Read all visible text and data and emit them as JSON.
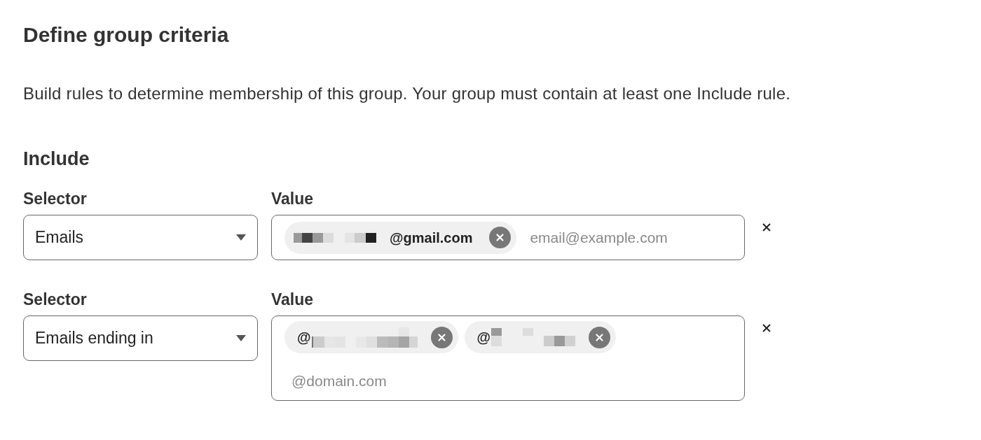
{
  "title": "Define group criteria",
  "description": "Build rules to determine membership of this group. Your group must contain at least one Include rule.",
  "include": {
    "heading": "Include",
    "rules": [
      {
        "selector": {
          "label": "Selector",
          "value": "Emails"
        },
        "value": {
          "label": "Value",
          "chips": [
            {
              "parts": [
                {
                  "kind": "redacted"
                },
                {
                  "kind": "text",
                  "text": "@gmail.com"
                }
              ]
            }
          ],
          "placeholder": "email@example.com"
        }
      },
      {
        "selector": {
          "label": "Selector",
          "value": "Emails ending in"
        },
        "value": {
          "label": "Value",
          "chips": [
            {
              "parts": [
                {
                  "kind": "text",
                  "text": "@"
                },
                {
                  "kind": "redacted"
                }
              ]
            },
            {
              "parts": [
                {
                  "kind": "text",
                  "text": "@"
                },
                {
                  "kind": "redacted"
                }
              ]
            }
          ],
          "placeholder": "@domain.com"
        }
      }
    ]
  }
}
